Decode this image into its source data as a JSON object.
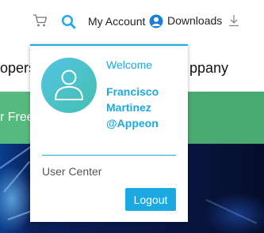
{
  "nav": {
    "cart_icon": "cart-icon",
    "search_icon": "search-icon",
    "account_label": "My Account",
    "account_icon": "user-circle-icon",
    "downloads_label": "Downloads",
    "downloads_icon": "download-icon",
    "accent_color": "#1ba9e1"
  },
  "page": {
    "headline_left": "opers",
    "headline_right": "ppany",
    "trial_button_label": "r Free",
    "band_color": "#4aab72"
  },
  "account_menu": {
    "welcome": "Welcome",
    "user_name": "Francisco Martinez @Appeon",
    "user_center": "User Center",
    "logout_label": "Logout",
    "avatar_icon": "user-silhouette-icon"
  }
}
